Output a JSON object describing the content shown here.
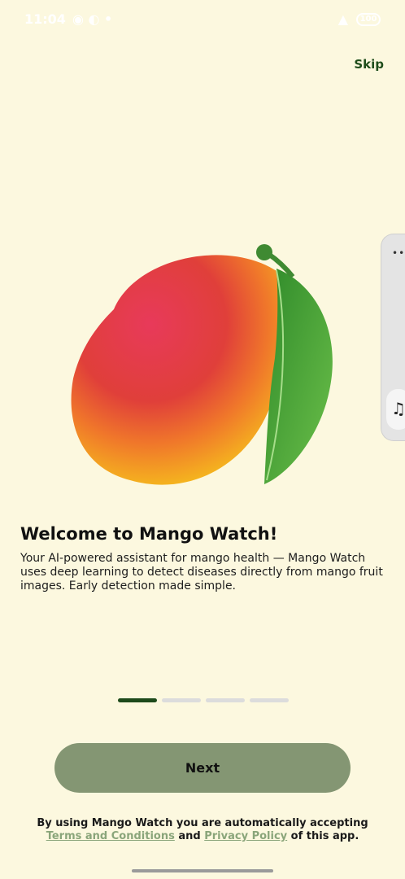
{
  "status_bar": {
    "time": "11:04",
    "battery": "100"
  },
  "header": {
    "skip_label": "Skip"
  },
  "onboarding": {
    "title": "Welcome to Mango Watch!",
    "description": "Your AI-powered assistant for mango health — Mango Watch uses deep learning to detect diseases directly from mango fruit images. Early detection made simple.",
    "page_index": 1,
    "page_count": 4,
    "next_label": "Next"
  },
  "footer": {
    "prefix": "By using Mango Watch you are automatically accepting",
    "terms_link": "Terms and Conditions",
    "and_text": "and",
    "privacy_link": "Privacy Policy",
    "suffix": "of this app."
  },
  "colors": {
    "background": "#fcf8df",
    "accent_dark": "#1d4a1b",
    "button": "#849673",
    "link": "#8aa57a"
  },
  "icons": [
    "mango-illustration",
    "music-note-icon",
    "more-dots-icon"
  ]
}
